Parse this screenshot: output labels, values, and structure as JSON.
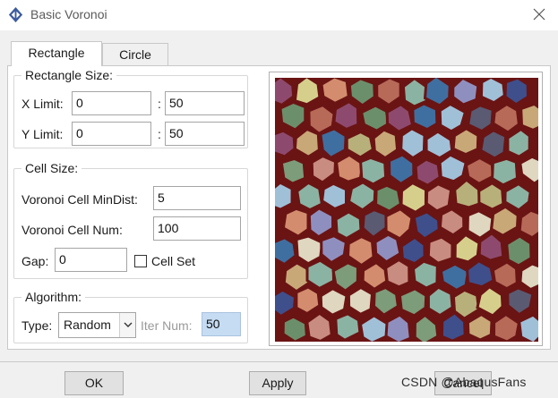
{
  "window": {
    "title": "Basic Voronoi",
    "icon": "abaqus-logo-icon",
    "close_icon": "close-icon"
  },
  "tabs": [
    {
      "label": "Rectangle",
      "active": true
    },
    {
      "label": "Circle",
      "active": false
    }
  ],
  "rectangle_size": {
    "legend": "Rectangle Size:",
    "x_limit_label": "X Limit:",
    "x_min": "0",
    "x_max": "50",
    "y_limit_label": "Y Limit:",
    "y_min": "0",
    "y_max": "50",
    "separator": ":"
  },
  "cell_size": {
    "legend": "Cell Size:",
    "mindist_label": "Voronoi Cell MinDist:",
    "mindist_value": "5",
    "num_label": "Voronoi Cell Num:",
    "num_value": "100",
    "gap_label": "Gap:",
    "gap_value": "0",
    "cellset_label": "Cell Set",
    "cellset_checked": false
  },
  "algorithm": {
    "legend": "Algorithm:",
    "type_label": "Type:",
    "type_value": "Random",
    "iter_label": "Iter Num:",
    "iter_value": "50"
  },
  "preview": {
    "edge_color": "#6a1414",
    "cell_colors": [
      "#3f6fa0",
      "#c9a878",
      "#8f8fbf",
      "#d38d6e",
      "#7c9c7a",
      "#b8b07a",
      "#a0c0d8",
      "#8e4a6e",
      "#d6cf8c",
      "#5a5a72",
      "#6b8f6b",
      "#c98c80",
      "#dfd7c0",
      "#b86a58",
      "#3e4f8c",
      "#8bb3a3"
    ]
  },
  "buttons": {
    "ok": "OK",
    "apply": "Apply",
    "cancel": "Cancel"
  },
  "watermark": "CSDN @AbaqusFans"
}
